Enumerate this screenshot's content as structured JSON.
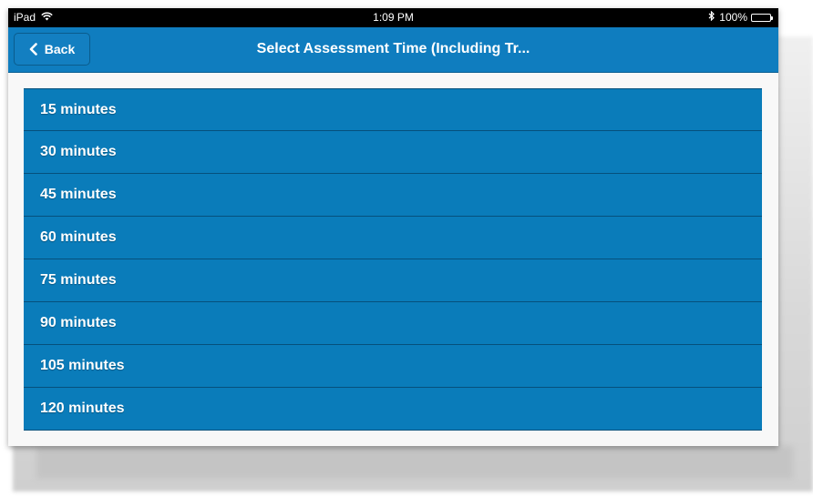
{
  "status_bar": {
    "device": "iPad",
    "time": "1:09 PM",
    "battery": "100%",
    "icons": [
      "wifi-icon",
      "bluetooth-icon",
      "battery-icon"
    ]
  },
  "nav": {
    "back_label": "Back",
    "title": "Select Assessment Time (Including Tr..."
  },
  "options": [
    {
      "label": "15 minutes"
    },
    {
      "label": "30 minutes"
    },
    {
      "label": "45 minutes"
    },
    {
      "label": "60 minutes"
    },
    {
      "label": "75 minutes"
    },
    {
      "label": "90 minutes"
    },
    {
      "label": "105 minutes"
    },
    {
      "label": "120 minutes"
    }
  ],
  "colors": {
    "nav_blue": "#0f7dbf",
    "list_blue": "#0a7cba",
    "separator": "#06507c"
  }
}
